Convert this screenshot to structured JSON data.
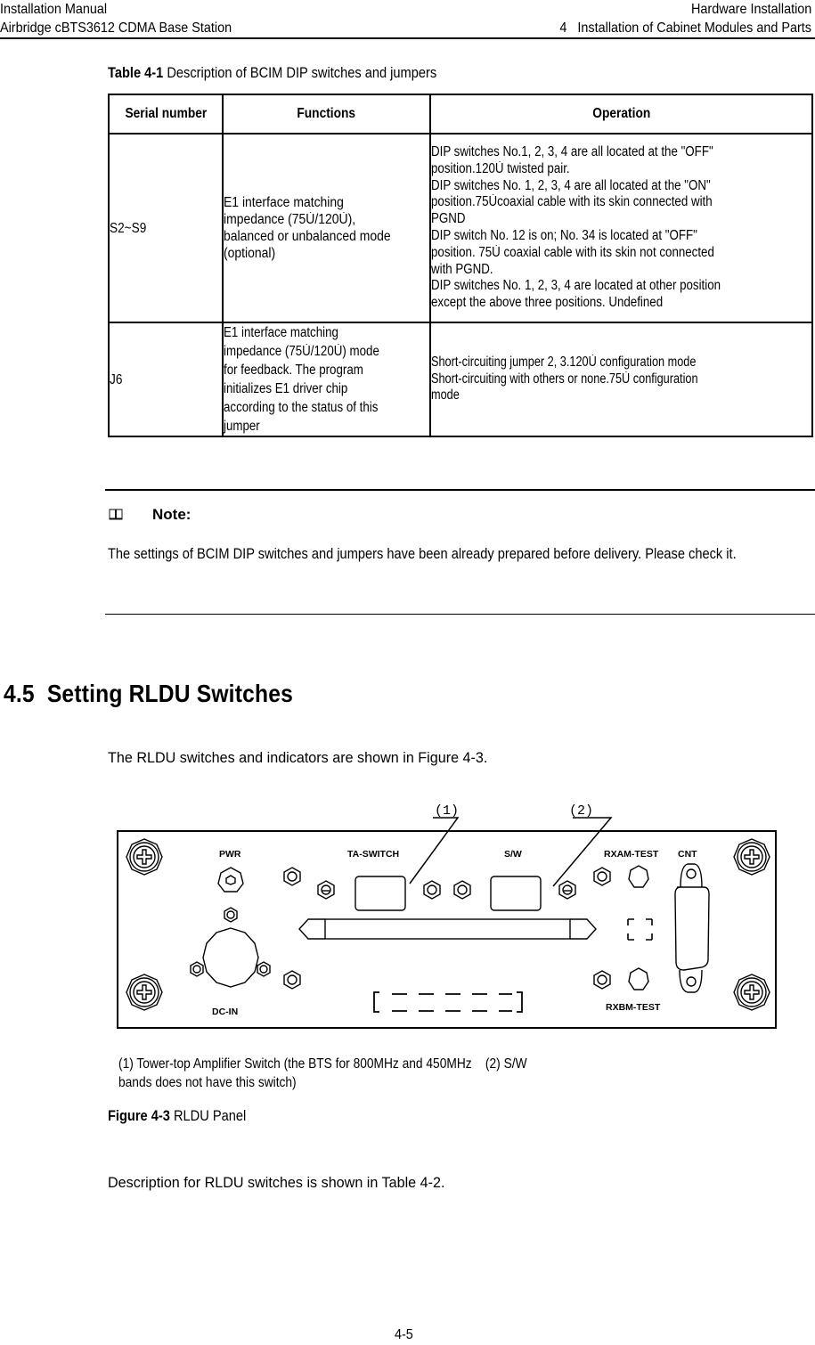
{
  "header": {
    "left_line1": "Installation Manual",
    "left_line2": "Airbridge cBTS3612 CDMA Base Station",
    "right_line1": "Hardware Installation",
    "right_line2": "4   Installation of Cabinet Modules and Parts"
  },
  "table1": {
    "caption_label": "Table 4-1",
    "caption_text": "Description of BCIM DIP switches and jumpers",
    "columns": [
      "Serial number",
      "Functions",
      "Operation"
    ],
    "rows": [
      {
        "serial": "S2~S9",
        "function_lines": [
          "E1 interface matching",
          "impedance (75Ù/120Ù),",
          "balanced or unbalanced mode",
          "(optional)"
        ],
        "operation_lines": [
          "DIP switches No.1, 2, 3, 4 are all located at the \"OFF\"",
          "position.120Ù twisted pair.",
          "DIP switches No. 1, 2, 3, 4 are all located at the \"ON\"",
          "position.75Ùcoaxial cable with its skin connected with",
          "PGND",
          "DIP switch No. 12 is on; No. 34 is located at \"OFF\"",
          "position. 75Ù coaxial cable with its skin not connected",
          "with PGND.",
          "DIP switches No. 1, 2, 3, 4 are located at other position",
          "except the above three positions. Undefined"
        ]
      },
      {
        "serial": "J6",
        "function_lines": [
          "E1 interface matching",
          "impedance (75Ù/120Ù) mode",
          "for feedback. The program",
          "initializes E1 driver chip",
          "according to the status of this",
          "jumper"
        ],
        "operation_lines": [
          "Short-circuiting jumper 2, 3.120Ù configuration mode",
          "Short-circuiting with others or none.75Ù configuration",
          "mode"
        ]
      }
    ]
  },
  "note": {
    "icon": "book-icon",
    "title": "Note:",
    "body": "The settings of BCIM DIP switches and jumpers have been already prepared before delivery. Please check it."
  },
  "section": {
    "number_title": "4.5  Setting RLDU Switches",
    "intro": "The RLDU switches and indicators are shown in Figure 4-3.",
    "outro": "Description for RLDU switches is shown in Table 4-2."
  },
  "figure": {
    "callouts": [
      "(1)",
      "(2)"
    ],
    "panel_labels": {
      "pwr": "PWR",
      "ta_switch": "TA-SWITCH",
      "sw": "S/W",
      "rxam_test": "RXAM-TEST",
      "cnt": "CNT",
      "dc_in": "DC-IN",
      "rxbm_test": "RXBM-TEST"
    },
    "legend_line1": "(1) Tower-top Amplifier Switch (the BTS for 800MHz and 450MHz    (2) S/W",
    "legend_line2": "bands does not have this switch)",
    "caption_label": "Figure 4-3",
    "caption_text": "RLDU Panel"
  },
  "footer": {
    "page_number": "4-5"
  }
}
